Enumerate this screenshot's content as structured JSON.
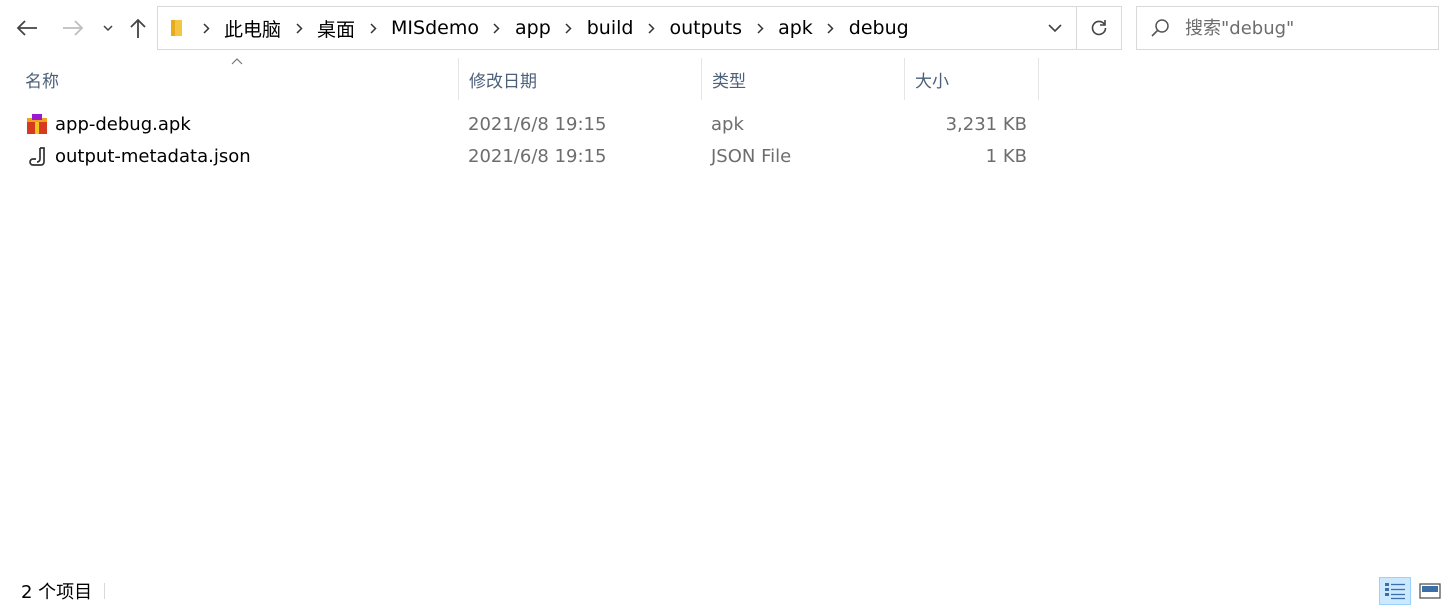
{
  "nav": {
    "back_icon": "arrow-left-icon",
    "forward_icon": "arrow-right-icon",
    "recent_icon": "chevron-down-icon",
    "up_icon": "arrow-up-icon"
  },
  "address": {
    "folder_icon": "folder-icon",
    "breadcrumbs": [
      "此电脑",
      "桌面",
      "MISdemo",
      "app",
      "build",
      "outputs",
      "apk",
      "debug"
    ],
    "refresh_icon": "refresh-icon"
  },
  "search": {
    "placeholder": "搜索\"debug\"",
    "icon": "search-icon"
  },
  "columns": [
    "名称",
    "修改日期",
    "类型",
    "大小"
  ],
  "files": [
    {
      "name": "app-debug.apk",
      "modified": "2021/6/8 19:15",
      "type": "apk",
      "size": "3,231 KB",
      "icon": "apk-package-icon"
    },
    {
      "name": "output-metadata.json",
      "modified": "2021/6/8 19:15",
      "type": "JSON File",
      "size": "1 KB",
      "icon": "json-file-icon"
    }
  ],
  "status": {
    "count_text": "2 个项目"
  },
  "colors": {
    "header_text": "#4c607a",
    "secondary_text": "#6d6d6d",
    "selection": "#cce8ff",
    "folder": "#f4c542"
  }
}
